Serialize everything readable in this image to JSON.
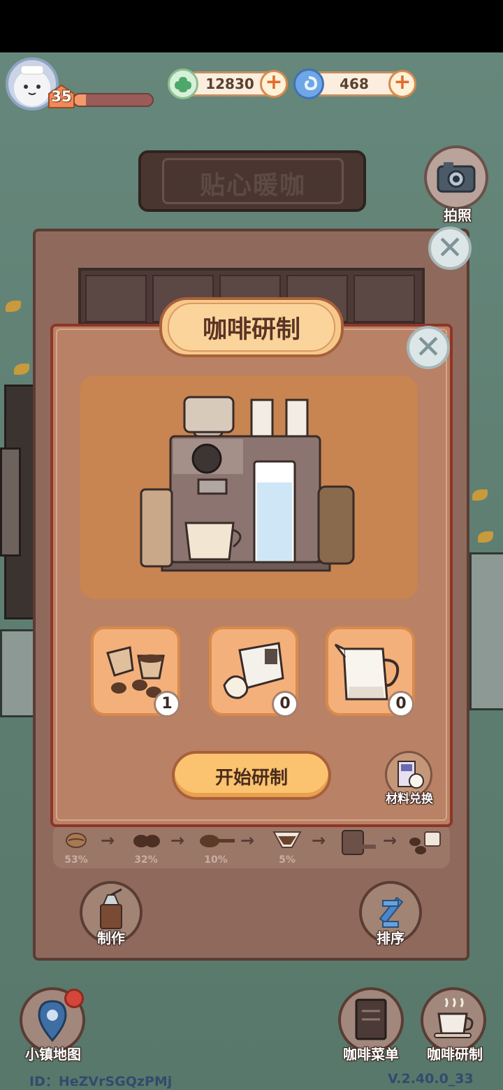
{
  "player": {
    "level": "35",
    "xp_fraction": 0.15
  },
  "currencies": [
    {
      "name": "clover-coin",
      "value": "12830"
    },
    {
      "name": "blue-swirl-gem",
      "value": "468"
    }
  ],
  "shop_sign": "贴心暖咖",
  "camera_label": "拍照",
  "dialog": {
    "title": "咖啡研制",
    "ingredients": [
      {
        "icon": "coffee-beans-cup-icon",
        "count": "1"
      },
      {
        "icon": "sugar-bag-icon",
        "count": "0"
      },
      {
        "icon": "milk-jug-icon",
        "count": "0"
      }
    ],
    "start_label": "开始研制",
    "material_exchange_label": "材料兑换"
  },
  "process_steps": [
    {
      "icon": "coffee-bean-icon",
      "percent": "53%"
    },
    {
      "icon": "roasted-beans-icon",
      "percent": "32%"
    },
    {
      "icon": "ground-coffee-spoon-icon",
      "percent": "10%"
    },
    {
      "icon": "drip-filter-icon",
      "percent": "5%"
    },
    {
      "icon": "coffee-press-icon",
      "percent": ""
    },
    {
      "icon": "coffee-cup-beans-icon",
      "percent": ""
    }
  ],
  "panel_buttons": {
    "make_label": "制作",
    "sort_label": "排序"
  },
  "bottom_nav": {
    "map_label": "小镇地图",
    "menu_label": "咖啡菜单",
    "research_label": "咖啡研制"
  },
  "footer": {
    "id_text": "ID：HeZVrSGQzPMj",
    "version": "V.2.40.0_33"
  },
  "colors": {
    "panel_brown": "#8f6a5c",
    "dialog_tan": "#b98165",
    "accent_orange": "#f4b07a",
    "start_yellow": "#fbc36f"
  }
}
